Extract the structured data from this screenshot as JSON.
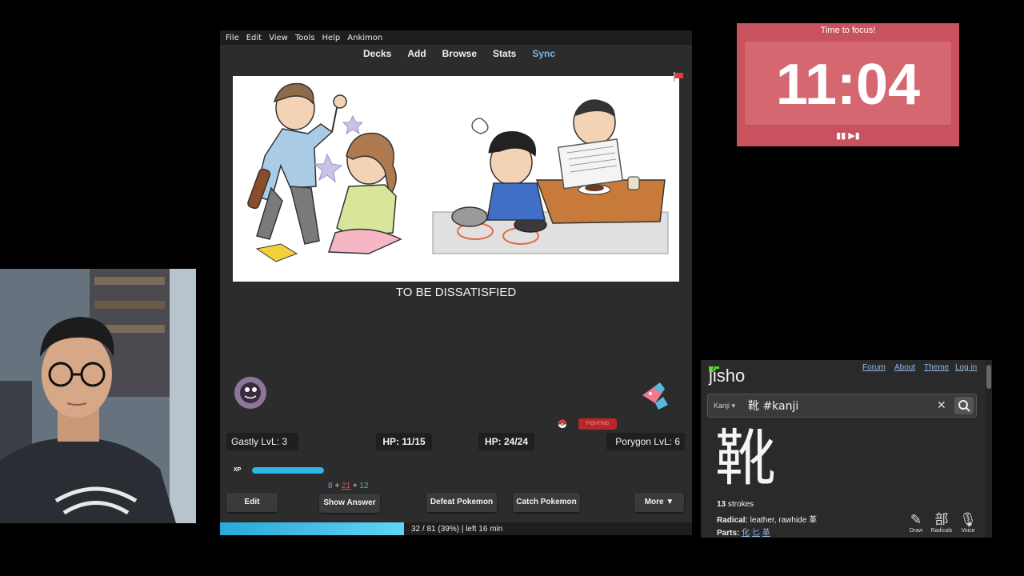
{
  "anki": {
    "menu": [
      "File",
      "Edit",
      "View",
      "Tools",
      "Help",
      "Ankimon"
    ],
    "toolbar": {
      "decks": "Decks",
      "add": "Add",
      "browse": "Browse",
      "stats": "Stats",
      "sync": "Sync"
    },
    "answer_text": "TO BE DISSATISFIED",
    "battle": {
      "player": "Gastly LvL: 3",
      "player_hp": "HP: 11/15",
      "enemy_hp": "HP: 24/24",
      "enemy": "Porygon LvL: 6",
      "type_badge": "FIGHTING",
      "xp_label": "XP",
      "xp_fraction": 1.0
    },
    "counts": {
      "new": "8",
      "learn": "21",
      "review": "12",
      "plus": "+"
    },
    "buttons": {
      "edit": "Edit",
      "show_answer": "Show Answer",
      "defeat": "Defeat Pokemon",
      "catch": "Catch Pokemon",
      "more": "More ▼"
    },
    "progress": {
      "text": "32 / 81 (39%) | left 16 min",
      "fraction": 0.39
    }
  },
  "timer": {
    "title": "Time to focus!",
    "time": "11:04",
    "controls": "▮▮ ▶▮"
  },
  "jisho": {
    "logo": "jisho",
    "nav": [
      "Forum",
      "About",
      "Theme",
      "Log in"
    ],
    "search_mode": "Kanji ▾",
    "search_value": "靴 #kanji",
    "kanji": "靴",
    "strokes_num": "13",
    "strokes_label": " strokes",
    "radical_label": "Radical:",
    "radical_value": " leather, rawhide 革",
    "parts_label": "Parts:",
    "parts": [
      "化",
      "匕",
      "革"
    ],
    "tools": [
      {
        "icon": "✎",
        "label": "Draw"
      },
      {
        "icon": "部",
        "label": "Radicals"
      },
      {
        "icon": "🎙",
        "label": "Voice"
      }
    ]
  },
  "colors": {
    "timer_bg": "#c8525d",
    "anki_bg": "#2c2c2c",
    "sync_link": "#7fb2f0",
    "xp": "#2fb4e8"
  }
}
